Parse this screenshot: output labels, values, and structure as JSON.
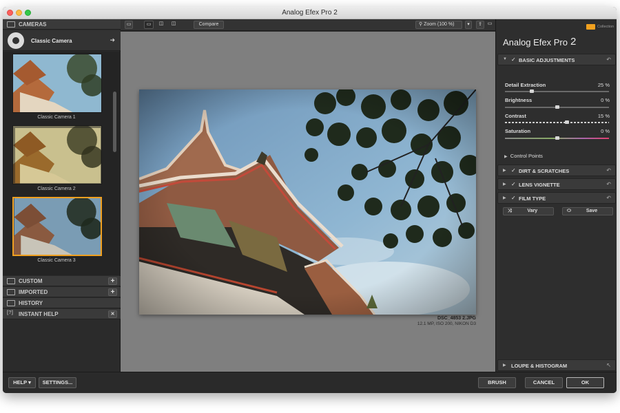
{
  "window": {
    "title": "Analog Efex Pro 2"
  },
  "left_panel": {
    "cameras_header": "CAMERAS",
    "selected_camera": "Classic Camera",
    "thumbnails": [
      {
        "label": "Classic Camera 1",
        "selected": false
      },
      {
        "label": "Classic Camera 2",
        "selected": false
      },
      {
        "label": "Classic Camera 3",
        "selected": true
      }
    ],
    "sections": [
      {
        "label": "CUSTOM",
        "has_add": true
      },
      {
        "label": "IMPORTED",
        "has_add": true
      },
      {
        "label": "HISTORY",
        "has_add": false
      },
      {
        "label": "INSTANT HELP",
        "has_add": true,
        "add_glyph": "✕"
      }
    ]
  },
  "toolbar": {
    "compare_label": "Compare",
    "zoom_label": "Zoom (100 %)"
  },
  "canvas": {
    "file_name": "DSC_4853 2.JPG",
    "file_info": "12.1 MP, ISO 200, NIKON D3",
    "background_color": "#7f7f7f"
  },
  "right_panel": {
    "brand_collection": "Collection",
    "title": "Analog Efex Pro",
    "title_number": "2",
    "basic_adjustments": {
      "label": "BASIC ADJUSTMENTS",
      "sliders": [
        {
          "label": "Detail Extraction",
          "value": "25 %",
          "fraction": 0.25
        },
        {
          "label": "Brightness",
          "value": "0 %",
          "fraction": 0.5
        },
        {
          "label": "Contrast",
          "value": "15 %",
          "fraction": 0.6
        },
        {
          "label": "Saturation",
          "value": "0 %",
          "fraction": 0.5
        }
      ],
      "control_points_label": "Control Points"
    },
    "sections": [
      {
        "label": "DIRT & SCRATCHES"
      },
      {
        "label": "LENS VIGNETTE"
      },
      {
        "label": "FILM TYPE"
      }
    ],
    "vary_label": "Vary",
    "save_label": "Save",
    "loupe_label": "LOUPE & HISTOGRAM"
  },
  "bottom_bar": {
    "help_label": "HELP",
    "settings_label": "SETTINGS...",
    "brush_label": "BRUSH",
    "cancel_label": "CANCEL",
    "ok_label": "OK"
  },
  "colors": {
    "accent": "#f0a020",
    "panel": "#2e2e2e",
    "saturation_end": "#e04070"
  }
}
